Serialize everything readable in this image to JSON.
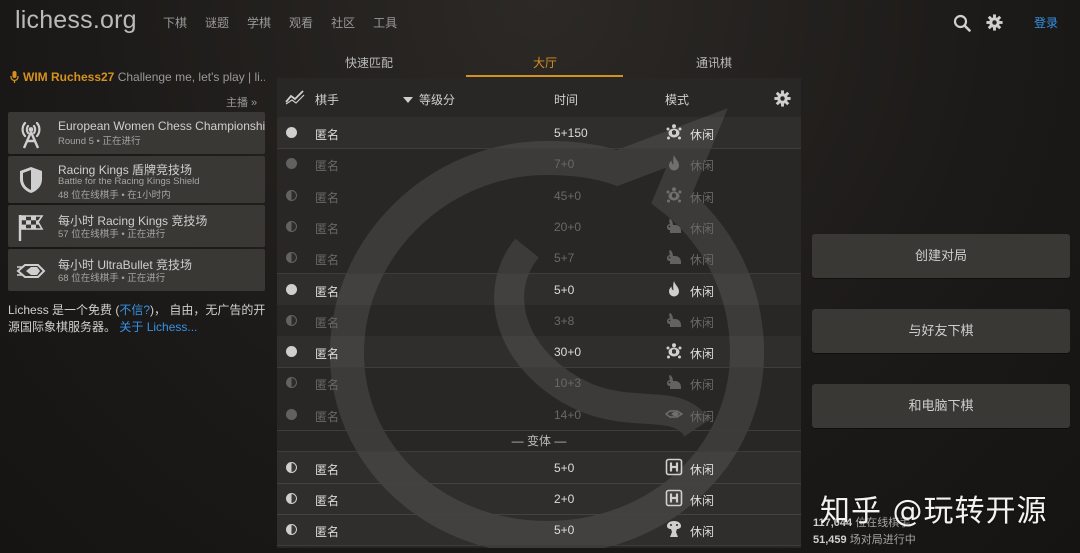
{
  "header": {
    "logo": "lichess.org",
    "nav": [
      "下棋",
      "谜题",
      "学棋",
      "观看",
      "社区",
      "工具"
    ],
    "login": "登录"
  },
  "streamer": {
    "name": "WIM Ruchess27",
    "message": " Challenge me, let's play | li..."
  },
  "streams_more": "主播 »",
  "tournaments": [
    {
      "name": "European Women Chess Championship",
      "line1": "Round 5 • 正在进行",
      "line2": "",
      "icon": "broadcast-icon"
    },
    {
      "name": "Racing Kings 盾牌竞技场",
      "line1": "Battle for the Racing Kings Shield",
      "line2": "48 位在线棋手 • 在1小时内",
      "icon": "shield-icon"
    },
    {
      "name": "每小时 Racing Kings 竞技场",
      "line1": "57 位在线棋手 • 正在进行",
      "line2": "",
      "icon": "checkered-flag-icon"
    },
    {
      "name": "每小时 UltraBullet 竞技场",
      "line1": "68 位在线棋手 • 正在进行",
      "line2": "",
      "icon": "ultrabullet-icon"
    }
  ],
  "about": {
    "text1": "Lichess 是一个免费 (",
    "link1": "不信?",
    "text2": ")， 自由，无广告的开源国际象棋服务器。",
    "link2": "关于 Lichess..."
  },
  "tabs": [
    "快速匹配",
    "大厅",
    "通讯棋"
  ],
  "active_tab": "大厅",
  "lobby": {
    "headers": {
      "player": "棋手",
      "rating": "等级分",
      "time": "时间",
      "mode": "模式"
    },
    "rows": [
      {
        "color": "white",
        "player": "匿名",
        "time": "5+150",
        "icon": "turtle-icon",
        "mode": "休闲",
        "dim": false
      },
      {
        "color": "white",
        "player": "匿名",
        "time": "7+0",
        "icon": "fire-icon",
        "mode": "休闲",
        "dim": true
      },
      {
        "color": "half",
        "player": "匿名",
        "time": "45+0",
        "icon": "turtle-icon",
        "mode": "休闲",
        "dim": true
      },
      {
        "color": "half",
        "player": "匿名",
        "time": "20+0",
        "icon": "rabbit-icon",
        "mode": "休闲",
        "dim": true
      },
      {
        "color": "half",
        "player": "匿名",
        "time": "5+7",
        "icon": "rabbit-icon",
        "mode": "休闲",
        "dim": true
      },
      {
        "color": "white",
        "player": "匿名",
        "time": "5+0",
        "icon": "fire-icon",
        "mode": "休闲",
        "dim": false
      },
      {
        "color": "half",
        "player": "匿名",
        "time": "3+8",
        "icon": "rabbit-icon",
        "mode": "休闲",
        "dim": true
      },
      {
        "color": "white",
        "player": "匿名",
        "time": "30+0",
        "icon": "turtle-icon",
        "mode": "休闲",
        "dim": false
      },
      {
        "color": "half",
        "player": "匿名",
        "time": "10+3",
        "icon": "rabbit-icon",
        "mode": "休闲",
        "dim": true
      },
      {
        "color": "white",
        "player": "匿名",
        "time": "14+0",
        "icon": "bullet-icon",
        "mode": "休闲",
        "dim": true
      }
    ],
    "variant_header": "— 变体 —",
    "variant_rows": [
      {
        "color": "half",
        "player": "匿名",
        "time": "5+0",
        "icon": "horde-icon",
        "mode": "休闲"
      },
      {
        "color": "half",
        "player": "匿名",
        "time": "2+0",
        "icon": "horde-icon",
        "mode": "休闲"
      },
      {
        "color": "half",
        "player": "匿名",
        "time": "5+0",
        "icon": "atomic-icon",
        "mode": "休闲"
      }
    ]
  },
  "actions": [
    "创建对局",
    "与好友下棋",
    "和电脑下棋"
  ],
  "counts": {
    "players_num": "117,044",
    "players_label": " 位在线棋手",
    "games_num": "51,459",
    "games_label": " 场对局进行中"
  },
  "watermark": "知乎 @玩转开源"
}
